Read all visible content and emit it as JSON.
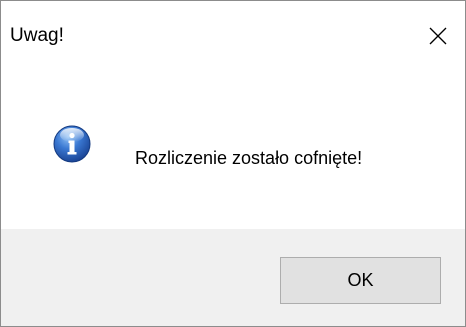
{
  "window": {
    "title": "Uwag!",
    "close_icon": "close-icon"
  },
  "content": {
    "icon": "info-icon",
    "message": "Rozliczenie zostało cofnięte!"
  },
  "footer": {
    "ok_label": "OK"
  },
  "colors": {
    "info_icon_blue": "#2a5fb8",
    "footer_background": "#f0f0f0",
    "button_background": "#e1e1e1",
    "button_border": "#adadad"
  }
}
